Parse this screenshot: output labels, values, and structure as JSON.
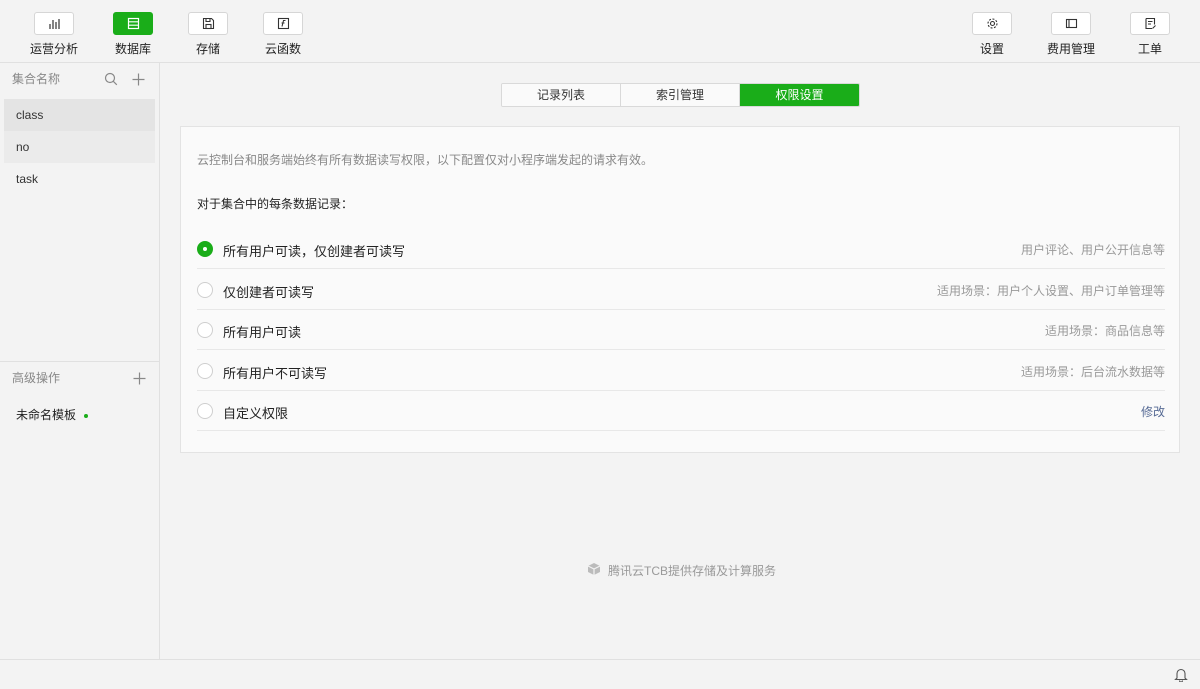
{
  "toolbar": {
    "left": [
      {
        "label": "运营分析",
        "icon": "bar-chart-icon"
      },
      {
        "label": "数据库",
        "icon": "database-icon"
      },
      {
        "label": "存储",
        "icon": "storage-icon"
      },
      {
        "label": "云函数",
        "icon": "cloud-function-icon"
      }
    ],
    "right": [
      {
        "label": "设置",
        "icon": "gear-icon"
      },
      {
        "label": "费用管理",
        "icon": "wallet-icon"
      },
      {
        "label": "工单",
        "icon": "ticket-icon"
      }
    ],
    "active": "数据库"
  },
  "sidebar": {
    "header": "集合名称",
    "collections": [
      {
        "label": "class"
      },
      {
        "label": "no"
      },
      {
        "label": "task"
      }
    ],
    "advanced_header": "高级操作",
    "advanced_item": "未命名模板"
  },
  "tabs": [
    {
      "label": "记录列表"
    },
    {
      "label": "索引管理"
    },
    {
      "label": "权限设置"
    }
  ],
  "active_tab": "权限设置",
  "permissions": {
    "description": "云控制台和服务端始终有所有数据读写权限，以下配置仅对小程序端发起的请求有效。",
    "subtitle": "对于集合中的每条数据记录：",
    "options": [
      {
        "label": "所有用户可读，仅创建者可读写",
        "hint": "用户评论、用户公开信息等",
        "checked": true
      },
      {
        "label": "仅创建者可读写",
        "hint": "适用场景：用户个人设置、用户订单管理等",
        "checked": false
      },
      {
        "label": "所有用户可读",
        "hint": "适用场景：商品信息等",
        "checked": false
      },
      {
        "label": "所有用户不可读写",
        "hint": "适用场景：后台流水数据等",
        "checked": false
      },
      {
        "label": "自定义权限",
        "hint": "修改",
        "checked": false
      }
    ]
  },
  "footer": {
    "text": "腾讯云TCB提供存储及计算服务"
  },
  "colors": {
    "accent": "#1aad19",
    "link": "#576b95"
  }
}
